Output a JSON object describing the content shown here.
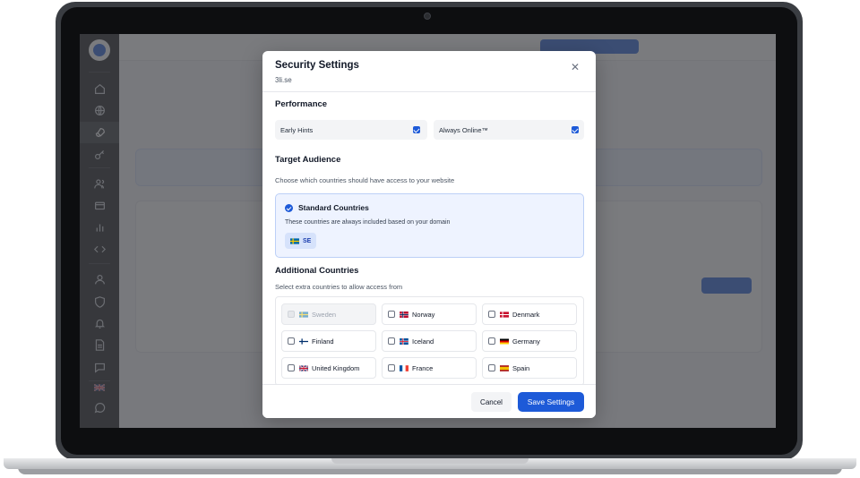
{
  "modal": {
    "title": "Security Settings",
    "subtitle": "3li.se",
    "close_icon": "close-icon",
    "performance": {
      "heading": "Performance",
      "toggles": [
        {
          "label": "Early Hints",
          "checked": true
        },
        {
          "label": "Always Online™",
          "checked": true
        }
      ]
    },
    "audience": {
      "heading": "Target Audience",
      "description": "Choose which countries should have access to your website",
      "standard": {
        "title": "Standard Countries",
        "description": "These countries are always included based on your domain",
        "chip": "SE"
      },
      "additional": {
        "heading": "Additional Countries",
        "description": "Select extra countries to allow access from",
        "countries": [
          {
            "name": "Sweden",
            "checked": false,
            "disabled": true
          },
          {
            "name": "Norway",
            "checked": false,
            "disabled": false
          },
          {
            "name": "Denmark",
            "checked": false,
            "disabled": false
          },
          {
            "name": "Finland",
            "checked": false,
            "disabled": false
          },
          {
            "name": "Iceland",
            "checked": false,
            "disabled": false
          },
          {
            "name": "Germany",
            "checked": false,
            "disabled": false
          },
          {
            "name": "United Kingdom",
            "checked": false,
            "disabled": false
          },
          {
            "name": "France",
            "checked": false,
            "disabled": false
          },
          {
            "name": "Spain",
            "checked": false,
            "disabled": false
          }
        ]
      }
    },
    "footer": {
      "cancel_label": "Cancel",
      "save_label": "Save Settings"
    }
  },
  "colors": {
    "accent": "#1d5ad8",
    "sidebar": "#101114"
  },
  "sidebar": {
    "icons": [
      "home-icon",
      "globe-icon",
      "rocket-icon",
      "key-icon",
      "users-icon",
      "card-icon",
      "bar-chart-icon",
      "code-icon",
      "user-icon",
      "shield-icon",
      "bell-icon",
      "document-icon",
      "chat-icon",
      "flag-uk-icon",
      "support-chat-icon"
    ]
  }
}
